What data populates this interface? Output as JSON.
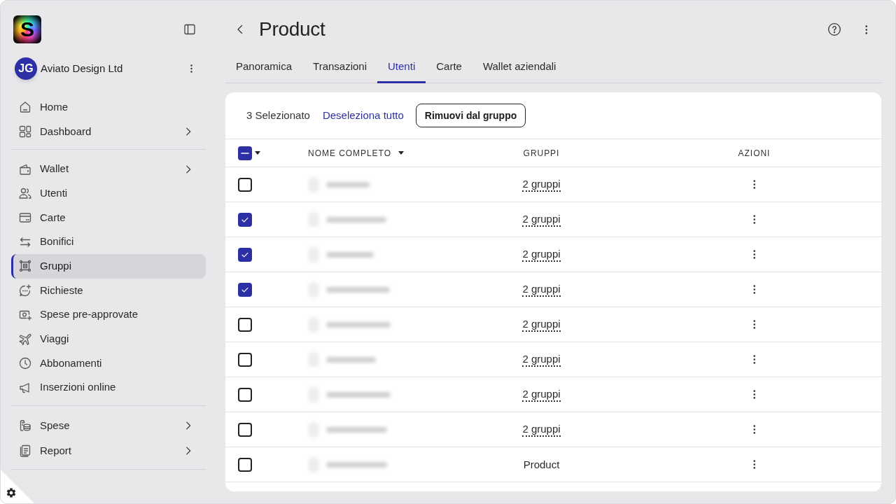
{
  "sidebar": {
    "logo": "S",
    "organization": {
      "initials": "JG",
      "name": "Aviato Design Ltd"
    },
    "sections": [
      {
        "items": [
          {
            "label": "Home",
            "selected": false,
            "has_submenu": false
          },
          {
            "label": "Dashboard",
            "selected": false,
            "has_submenu": true
          }
        ]
      },
      {
        "items": [
          {
            "label": "Wallet",
            "selected": false,
            "has_submenu": true
          },
          {
            "label": "Utenti",
            "selected": false,
            "has_submenu": false
          },
          {
            "label": "Carte",
            "selected": false,
            "has_submenu": false
          },
          {
            "label": "Bonifici",
            "selected": false,
            "has_submenu": false
          },
          {
            "label": "Gruppi",
            "selected": true,
            "has_submenu": false
          },
          {
            "label": "Richieste",
            "selected": false,
            "has_submenu": false
          },
          {
            "label": "Spese pre-approvate",
            "selected": false,
            "has_submenu": false
          },
          {
            "label": "Viaggi",
            "selected": false,
            "has_submenu": false
          },
          {
            "label": "Abbonamenti",
            "selected": false,
            "has_submenu": false
          },
          {
            "label": "Inserzioni online",
            "selected": false,
            "has_submenu": false
          }
        ]
      },
      {
        "items": [
          {
            "label": "Spese",
            "selected": false,
            "has_submenu": true
          },
          {
            "label": "Report",
            "selected": false,
            "has_submenu": true
          }
        ]
      }
    ]
  },
  "header": {
    "title": "Product"
  },
  "tabs": [
    {
      "label": "Panoramica",
      "selected": false
    },
    {
      "label": "Transazioni",
      "selected": false
    },
    {
      "label": "Utenti",
      "selected": true
    },
    {
      "label": "Carte",
      "selected": false
    },
    {
      "label": "Wallet aziendali",
      "selected": false
    }
  ],
  "toolbar": {
    "selection_count": "3 Selezionato",
    "deselect_link": "Deseleziona tutto",
    "remove_button": "Rimuovi dal gruppo"
  },
  "table": {
    "select_all": {
      "indeterminate": true
    },
    "columns": [
      {
        "label": "NOME COMPLETO",
        "sorted": true
      },
      {
        "label": "GRUPPI",
        "sorted": false
      },
      {
        "label": "AZIONI",
        "sorted": false
      }
    ],
    "rows": [
      {
        "selected": false,
        "groups": "2 gruppi",
        "underlined": true
      },
      {
        "selected": true,
        "groups": "2 gruppi",
        "underlined": true
      },
      {
        "selected": true,
        "groups": "2 gruppi",
        "underlined": true
      },
      {
        "selected": true,
        "groups": "2 gruppi",
        "underlined": true
      },
      {
        "selected": false,
        "groups": "2 gruppi",
        "underlined": true
      },
      {
        "selected": false,
        "groups": "2 gruppi",
        "underlined": true
      },
      {
        "selected": false,
        "groups": "2 gruppi",
        "underlined": true
      },
      {
        "selected": false,
        "groups": "2 gruppi",
        "underlined": true
      },
      {
        "selected": false,
        "groups": "Product",
        "underlined": false
      }
    ]
  }
}
